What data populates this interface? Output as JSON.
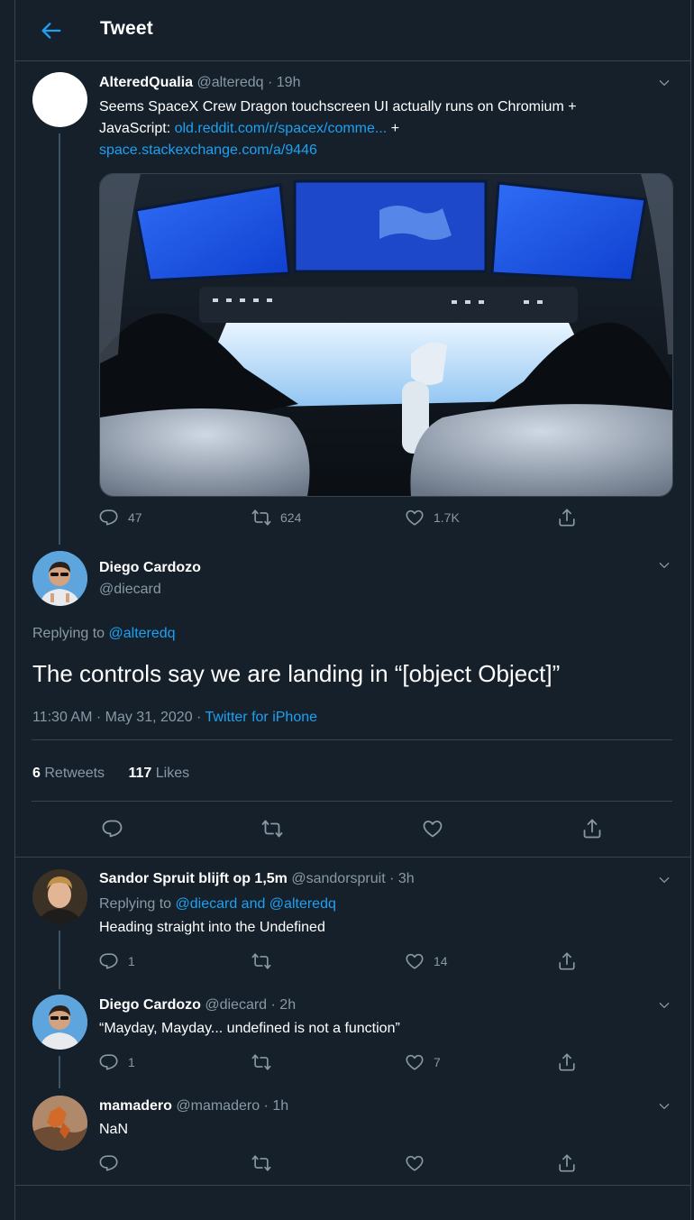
{
  "header": {
    "title": "Tweet"
  },
  "original_tweet": {
    "name": "AlteredQualia",
    "handle": "@alteredq",
    "time": "19h",
    "text_1": "Seems SpaceX Crew Dragon touchscreen UI actually runs on Chromium +",
    "text_2": "JavaScript:",
    "link_1": "old.reddit.com/r/spacex/comme...",
    "plus": "+",
    "link_2": "space.stackexchange.com/a/9446",
    "replies": "47",
    "retweets": "624",
    "likes": "1.7K"
  },
  "main_tweet": {
    "name": "Diego Cardozo",
    "handle": "@diecard",
    "replying_label": "Replying to",
    "replying_to": "@alteredq",
    "text": "The controls say we are landing in “[object Object]”",
    "timestamp": "11:30 AM · May 31, 2020 ·",
    "source": "Twitter for iPhone",
    "retweet_count": "6",
    "retweet_label": "Retweets",
    "like_count": "117",
    "like_label": "Likes"
  },
  "replies": [
    {
      "name": "Sandor Spruit blijft op 1,5m",
      "handle": "@sandorspruit",
      "time": "3h",
      "replying_label": "Replying to",
      "replying_to": "@diecard and @alteredq",
      "text": "Heading straight into the Undefined",
      "replies": "1",
      "likes": "14"
    },
    {
      "name": "Diego Cardozo",
      "handle": "@diecard",
      "time": "2h",
      "text": "“Mayday, Mayday... undefined is not a function”",
      "replies": "1",
      "likes": "7"
    },
    {
      "name": "mamadero",
      "handle": "@mamadero",
      "time": "1h",
      "text": "NaN"
    }
  ],
  "colors": {
    "background": "#15202b",
    "accent": "#1da1f2",
    "muted": "#8899a6",
    "border": "#38444d"
  },
  "icons": [
    "back-arrow-icon",
    "chevron-down-icon",
    "reply-icon",
    "retweet-icon",
    "like-icon",
    "share-icon"
  ]
}
